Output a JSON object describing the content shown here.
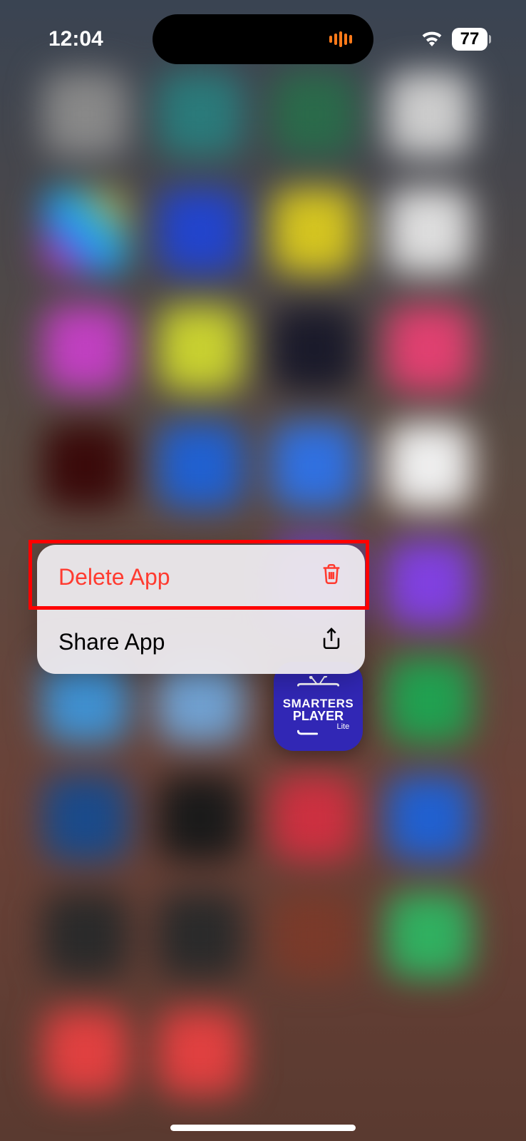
{
  "status_bar": {
    "time": "12:04",
    "battery": "77"
  },
  "context_menu": {
    "delete_label": "Delete App",
    "share_label": "Share App"
  },
  "focused_app": {
    "name_line1": "SMARTERS",
    "name_line2": "PLAYER",
    "name_lite": "Lite"
  },
  "colors": {
    "destructive": "#ff3b30",
    "highlight": "#ff0000",
    "app_icon_bg": "#3127b5",
    "audio_bar": "#ff7a1a"
  }
}
